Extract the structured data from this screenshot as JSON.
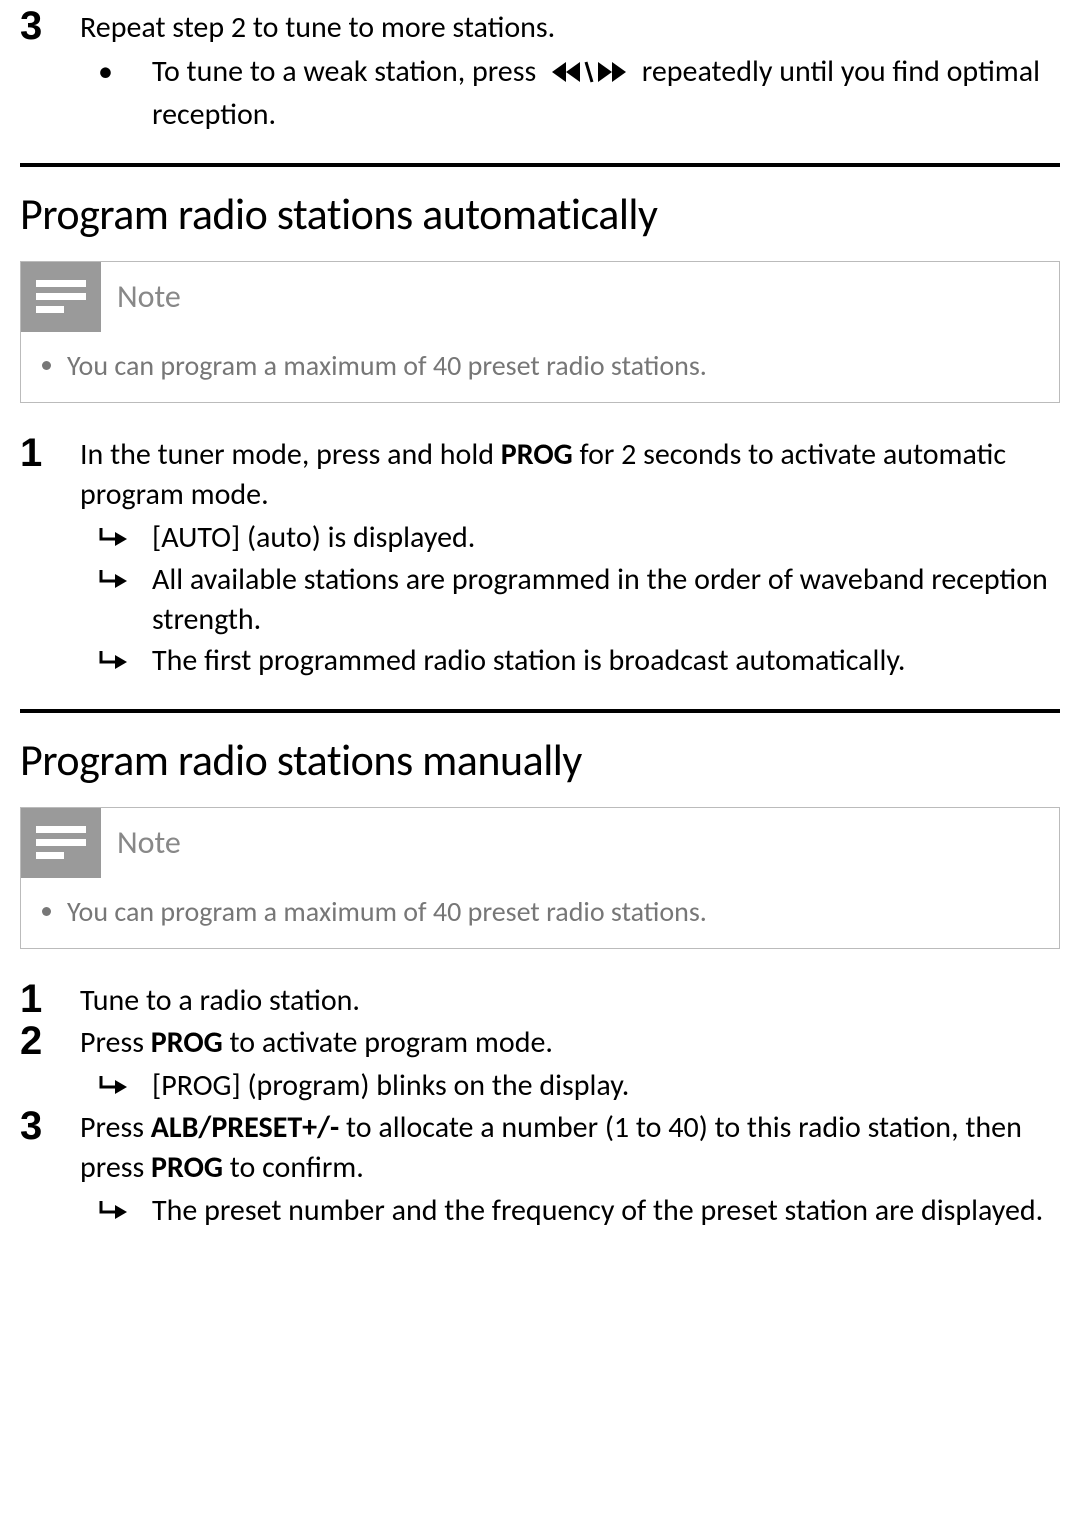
{
  "intro_step": {
    "number": "3",
    "text": "Repeat step 2 to tune to more stations.",
    "bullet": {
      "pre": "To tune to a weak station, press ",
      "icon_name": "rewind-forward-icon",
      "post": " repeatedly until you find optimal reception."
    }
  },
  "section_auto": {
    "heading": "Program radio stations automatically",
    "note_label": "Note",
    "note_item": "You can program a maximum of 40 preset radio stations.",
    "steps": [
      {
        "number": "1",
        "text_parts": [
          "In the tuner mode, press and hold ",
          "PROG",
          " for 2 seconds to activate automatic program mode."
        ],
        "arrows": [
          "[AUTO] (auto) is displayed.",
          "All available stations are programmed in the order of waveband reception strength.",
          "The first programmed radio station is broadcast automatically."
        ]
      }
    ]
  },
  "section_manual": {
    "heading": "Program radio stations manually",
    "note_label": "Note",
    "note_item": "You can program a maximum of 40 preset radio stations.",
    "steps": [
      {
        "number": "1",
        "text_parts": [
          "Tune to a radio station."
        ],
        "arrows": []
      },
      {
        "number": "2",
        "text_parts": [
          "Press ",
          "PROG",
          " to activate program mode."
        ],
        "arrows": [
          "[PROG] (program) blinks on the display."
        ]
      },
      {
        "number": "3",
        "text_parts": [
          "Press ",
          "ALB/PRESET+/-",
          " to allocate a number (1 to 40) to this radio station, then press ",
          "PROG",
          " to confirm."
        ],
        "arrows": [
          "The preset number and the frequency of the preset station are displayed."
        ]
      }
    ]
  }
}
